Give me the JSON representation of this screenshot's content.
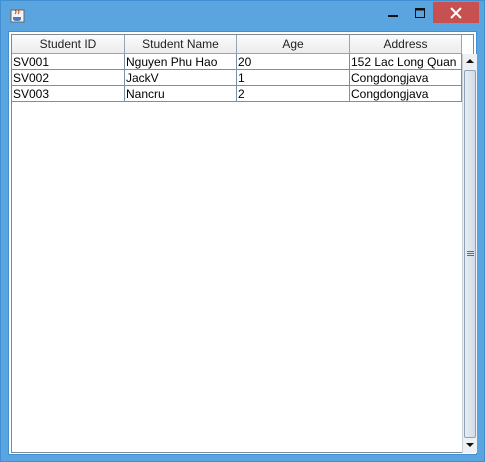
{
  "window": {
    "colors": {
      "titlebar": "#5aa5e0",
      "close": "#c75050"
    }
  },
  "table": {
    "columns": [
      "Student ID",
      "Student Name",
      "Age",
      "Address"
    ],
    "rows": [
      [
        "SV001",
        "Nguyen Phu Hao",
        "20",
        "152 Lac Long Quan"
      ],
      [
        "SV002",
        "JackV",
        "1",
        "Congdongjava"
      ],
      [
        "SV003",
        "Nancru",
        "2",
        "Congdongjava"
      ]
    ]
  },
  "icons": {
    "app": "java-app-icon",
    "minimize": "minimize-icon",
    "maximize": "maximize-icon",
    "close": "close-icon",
    "scroll_up": "arrow-up-icon",
    "scroll_down": "arrow-down-icon",
    "scroll_grip": "grip-icon"
  }
}
